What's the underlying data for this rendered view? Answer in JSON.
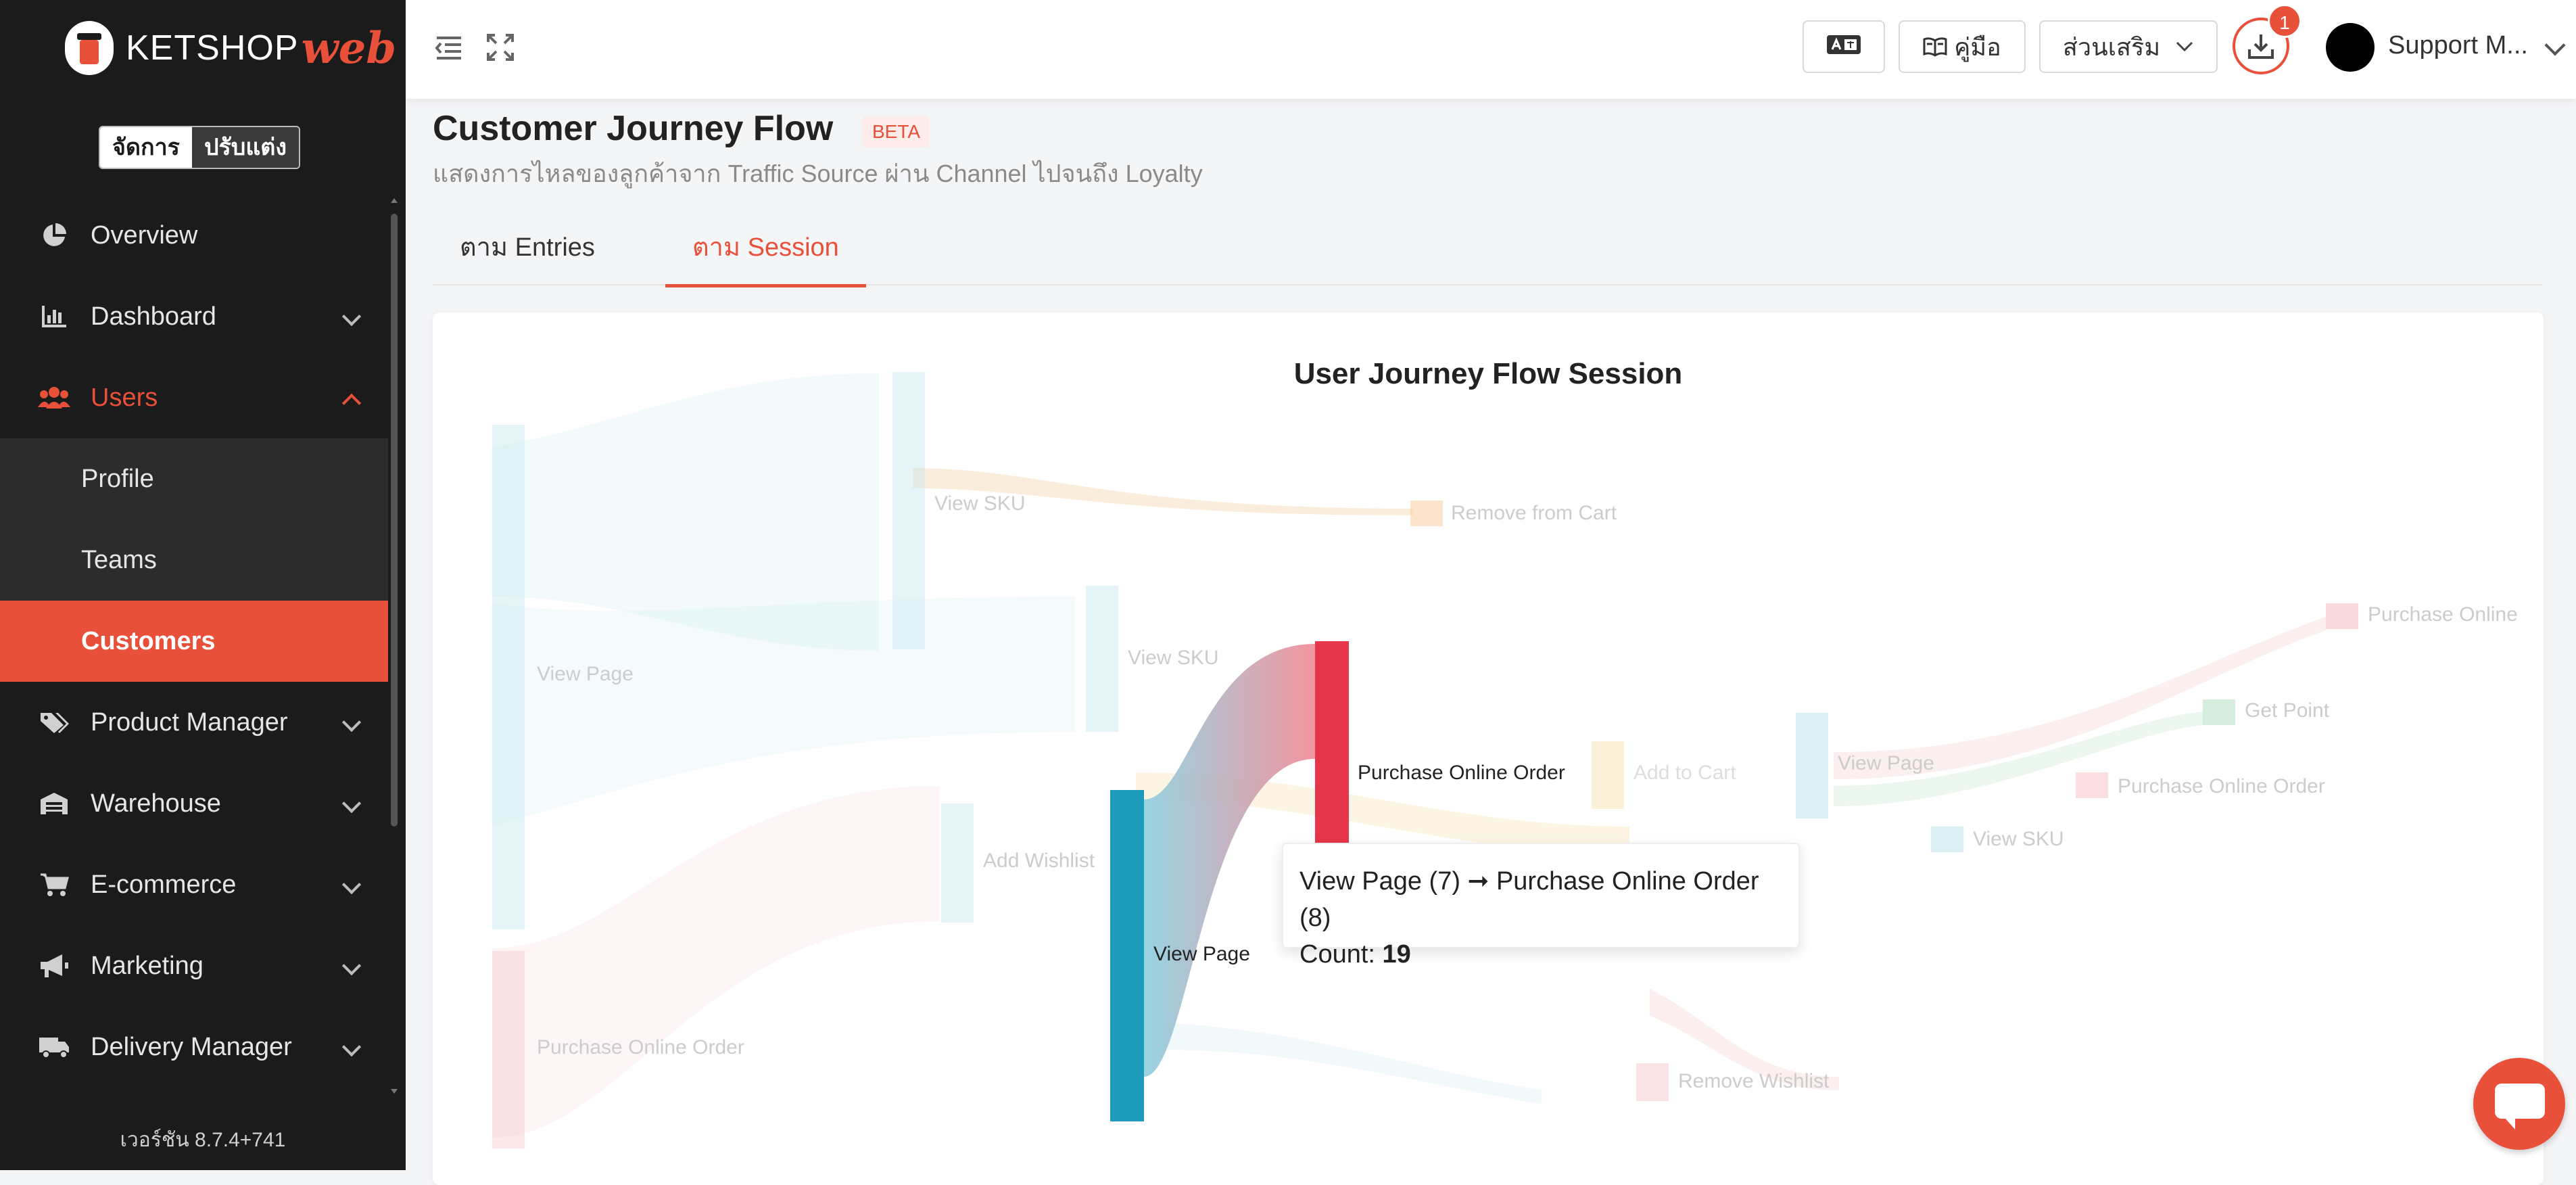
{
  "brand": {
    "name": "KETSHOP",
    "accent": "web",
    "accent_color": "#e8503a"
  },
  "mode_toggle": {
    "active": "จัดการ",
    "inactive": "ปรับแต่ง"
  },
  "sidebar": {
    "items": [
      {
        "label": "Overview",
        "icon": "pie-chart-icon"
      },
      {
        "label": "Dashboard",
        "icon": "bar-chart-icon",
        "has_children": true
      },
      {
        "label": "Users",
        "icon": "users-icon",
        "has_children": true,
        "open": true,
        "children": [
          {
            "label": "Profile"
          },
          {
            "label": "Teams"
          },
          {
            "label": "Customers",
            "active": true
          }
        ]
      },
      {
        "label": "Product Manager",
        "icon": "tag-icon",
        "has_children": true
      },
      {
        "label": "Warehouse",
        "icon": "warehouse-icon",
        "has_children": true
      },
      {
        "label": "E-commerce",
        "icon": "cart-icon",
        "has_children": true
      },
      {
        "label": "Marketing",
        "icon": "megaphone-icon",
        "has_children": true
      },
      {
        "label": "Delivery Manager",
        "icon": "truck-icon",
        "has_children": true
      }
    ],
    "version": "เวอร์ชัน 8.7.4+741"
  },
  "header": {
    "manual_label": "คู่มือ",
    "addons_label": "ส่วนเสริม",
    "download_badge": "1",
    "user_name": "Support M..."
  },
  "page": {
    "title": "Customer Journey Flow",
    "badge": "BETA",
    "subtitle": "แสดงการไหลของลูกค้าจาก Traffic Source ผ่าน Channel ไปจนถึง Loyalty",
    "tabs": [
      {
        "label": "ตาม Entries",
        "active": false
      },
      {
        "label": "ตาม Session",
        "active": true
      }
    ]
  },
  "chart_data": {
    "type": "sankey",
    "title": "User Journey Flow Session",
    "highlighted_link": {
      "source": "View Page",
      "target": "Purchase Online Order",
      "value": 19
    },
    "nodes": [
      "View Page",
      "Purchase Online Order",
      "View SKU",
      "Remove from Cart",
      "View SKU",
      "Add Wishlist",
      "View Page",
      "Purchase Online Order",
      "Add to Cart",
      "View Page",
      "View SKU",
      "Purchase Online Order",
      "Get Point",
      "Purchase Online",
      "Remove Wishlist"
    ],
    "tooltip": {
      "line1": "View Page (7) ➞ Purchase Online Order (8)",
      "count_label": "Count:",
      "count_value": "19"
    }
  }
}
